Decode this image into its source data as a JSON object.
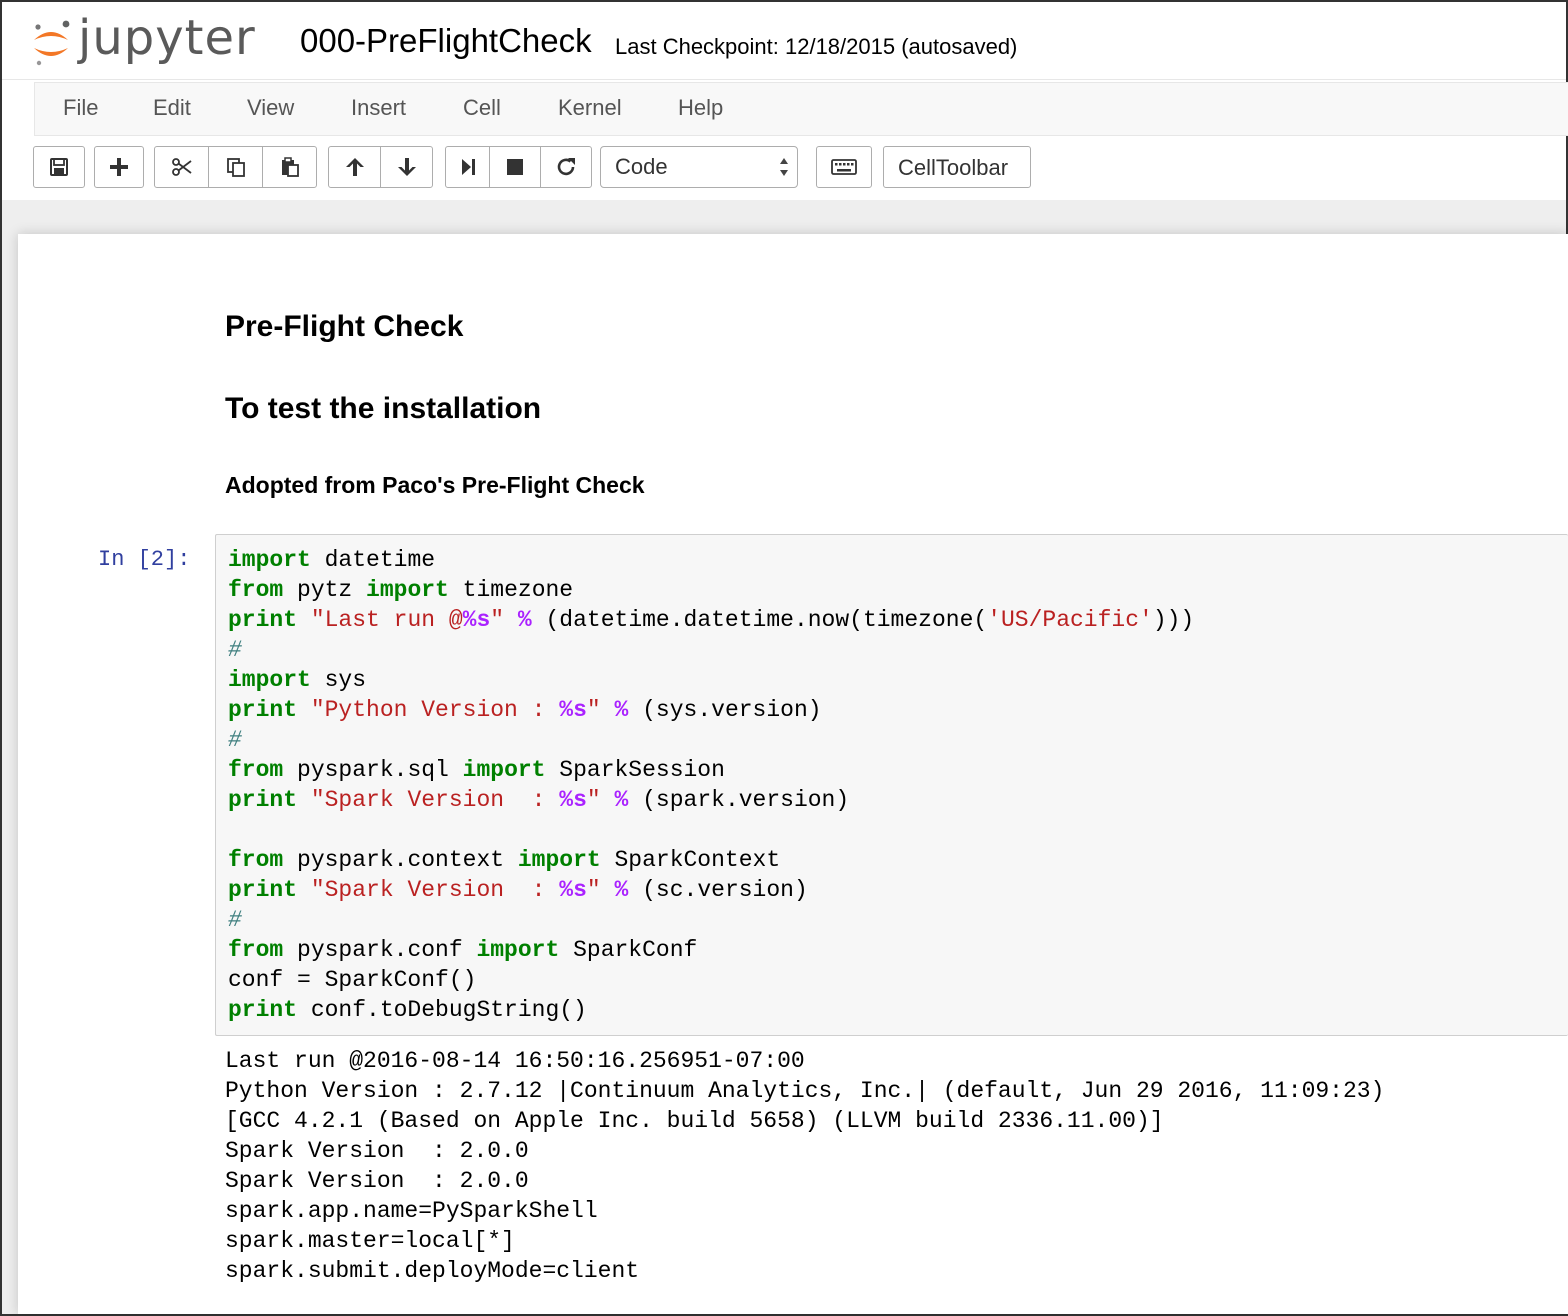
{
  "header": {
    "logo_text": "jupyter",
    "notebook_name": "000-PreFlightCheck",
    "checkpoint": "Last Checkpoint: 12/18/2015 (autosaved)"
  },
  "menubar": {
    "items": [
      "File",
      "Edit",
      "View",
      "Insert",
      "Cell",
      "Kernel",
      "Help"
    ]
  },
  "toolbar": {
    "cell_type": "Code",
    "celltoolbar_label": "CellToolbar",
    "icons": [
      "save-icon",
      "plus-icon",
      "cut-icon",
      "copy-icon",
      "paste-icon",
      "arrow-up-icon",
      "arrow-down-icon",
      "step-forward-icon",
      "stop-icon",
      "refresh-icon",
      "keyboard-icon"
    ]
  },
  "markdown": {
    "h1a": "Pre-Flight Check",
    "h1b": "To test the installation",
    "h3": "Adopted from Paco's Pre-Flight Check"
  },
  "cell": {
    "prompt": "In [2]:",
    "code_lines": [
      "import datetime",
      "from pytz import timezone",
      "print \"Last run @%s\" % (datetime.datetime.now(timezone('US/Pacific')))",
      "#",
      "import sys",
      "print \"Python Version : %s\" % (sys.version)",
      "#",
      "from pyspark.sql import SparkSession",
      "print \"Spark Version  : %s\" % (spark.version)",
      "",
      "from pyspark.context import SparkContext",
      "print \"Spark Version  : %s\" % (sc.version)",
      "#",
      "from pyspark.conf import SparkConf",
      "conf = SparkConf()",
      "print conf.toDebugString()"
    ],
    "output_lines": [
      "Last run @2016-08-14 16:50:16.256951-07:00",
      "Python Version : 2.7.12 |Continuum Analytics, Inc.| (default, Jun 29 2016, 11:09:23)",
      "[GCC 4.2.1 (Based on Apple Inc. build 5658) (LLVM build 2336.11.00)]",
      "Spark Version  : 2.0.0",
      "Spark Version  : 2.0.0",
      "spark.app.name=PySparkShell",
      "spark.master=local[*]",
      "spark.submit.deployMode=client"
    ]
  },
  "colors": {
    "keyword": "#008000",
    "string": "#ba2121",
    "operator": "#aa22ff",
    "prompt": "#303f9f",
    "logo_orange": "#f37726"
  }
}
